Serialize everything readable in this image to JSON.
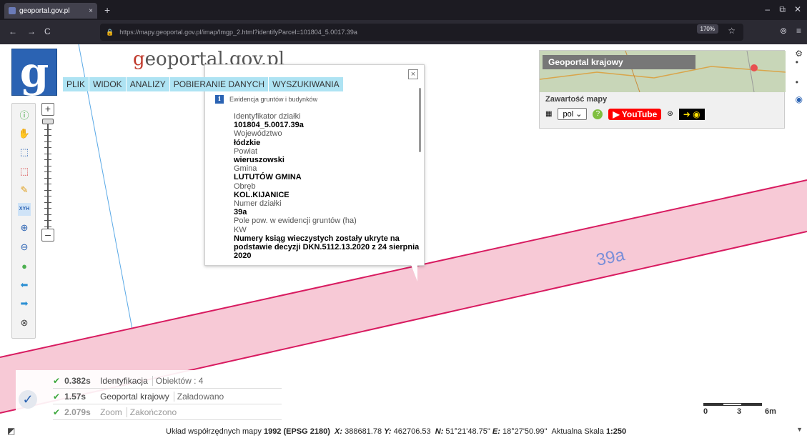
{
  "browser": {
    "tab_title": "geoportal.gov.pl",
    "tab_close": "×",
    "new_tab": "+",
    "url": "https://mapy.geoportal.gov.pl/imap/Imgp_2.html?identifyParcel=101804_5.0017.39a",
    "zoom": "170%",
    "back": "←",
    "forward": "→",
    "reload": "C",
    "minimize": "–",
    "restore": "⧉",
    "close": "✕",
    "star": "☆",
    "pocket": "⊚",
    "menu": "≡"
  },
  "header": {
    "logo_letter": "g",
    "site_title_prefix": "g",
    "site_title_rest": "eoportal.gov.pl"
  },
  "menu": {
    "items": [
      "PLIK",
      "WIDOK",
      "ANALIZY",
      "POBIERANIE DANYCH",
      "WYSZUKIWANIA"
    ]
  },
  "toolbar": {
    "zoom_in": "+",
    "zoom_out": "–",
    "tools": [
      {
        "name": "info-tool",
        "glyph": "ⓘ",
        "color": "#3aa73a"
      },
      {
        "name": "pan-tool",
        "glyph": "✋",
        "color": "#c9a24a"
      },
      {
        "name": "select-blue-tool",
        "glyph": "⬚",
        "color": "#2b63b3"
      },
      {
        "name": "select-red-tool",
        "glyph": "⬚",
        "color": "#d32f2f"
      },
      {
        "name": "pencil-tool",
        "glyph": "✎",
        "color": "#e0a020"
      },
      {
        "name": "xyh-tool",
        "glyph": "XYH",
        "color": "#2b63b3"
      },
      {
        "name": "zoom-in-tool",
        "glyph": "⊕",
        "color": "#2b63b3"
      },
      {
        "name": "zoom-out-tool",
        "glyph": "⊖",
        "color": "#2b63b3"
      },
      {
        "name": "globe-tool",
        "glyph": "●",
        "color": "#4caf50"
      },
      {
        "name": "back-tool",
        "glyph": "⬅",
        "color": "#2b8fd3"
      },
      {
        "name": "forward-tool",
        "glyph": "➡",
        "color": "#2b8fd3"
      },
      {
        "name": "clear-tool",
        "glyph": "⊗",
        "color": "#444444"
      }
    ]
  },
  "popup": {
    "close": "×",
    "layer_icon": "i",
    "layer_name": "Ewidencja gruntów i budynków",
    "fields": [
      {
        "label": "Identyfikator działki",
        "value": "101804_5.0017.39a"
      },
      {
        "label": "Województwo",
        "value": "łódzkie"
      },
      {
        "label": "Powiat",
        "value": "wieruszowski"
      },
      {
        "label": "Gmina",
        "value": "LUTUTÓW GMINA"
      },
      {
        "label": "Obręb",
        "value": "KOL.KIJANICE"
      },
      {
        "label": "Numer działki",
        "value": "39a"
      },
      {
        "label": "Pole pow. w ewidencji gruntów (ha)",
        "value": ""
      },
      {
        "label": "KW",
        "value": "Numery ksiąg wieczystych zostały ukryte na podstawie decyzji DKN.5112.13.2020 z 24 sierpnia 2020"
      }
    ]
  },
  "map": {
    "parcel_label": "39a",
    "parcel_fill": "#f7c9d6",
    "parcel_line": "#d81b60"
  },
  "panel": {
    "minimap_title": "Geoportal krajowy",
    "content_title": "Zawartość mapy",
    "lang": "pol",
    "lang_arrow": "⌄",
    "youtube": "▶ YouTube",
    "accessibility": "⊛",
    "contrast": "➜ ◉"
  },
  "right_side": {
    "settings": "⚙",
    "dot1": "•",
    "dot2": "•",
    "eye": "◉"
  },
  "log": {
    "check": "✓",
    "rows": [
      {
        "ok": "✔",
        "time": "0.382s",
        "name": "Identyfikacja",
        "status": "Obiektów : 4"
      },
      {
        "ok": "✔",
        "time": "1.57s",
        "name": "Geoportal krajowy",
        "status": "Załadowano"
      },
      {
        "ok": "✔",
        "time": "2.079s",
        "name": "Zoom",
        "status": "Zakończono"
      }
    ]
  },
  "scale": {
    "ticks": [
      "0",
      "3",
      "6m"
    ]
  },
  "status": {
    "corner": "◩",
    "prefix": "Układ współrzędnych mapy",
    "crs": "1992 (EPSG 2180)",
    "x_label": "X:",
    "x_value": "388681.78",
    "y_label": "Y:",
    "y_value": "462706.53",
    "n_label": "N:",
    "n_value": "51°21'48.75\"",
    "e_label": "E:",
    "e_value": "18°27'50.99\"",
    "scale_label": "Aktualna Skala",
    "scale_value": "1:250",
    "scroll": "▼"
  }
}
